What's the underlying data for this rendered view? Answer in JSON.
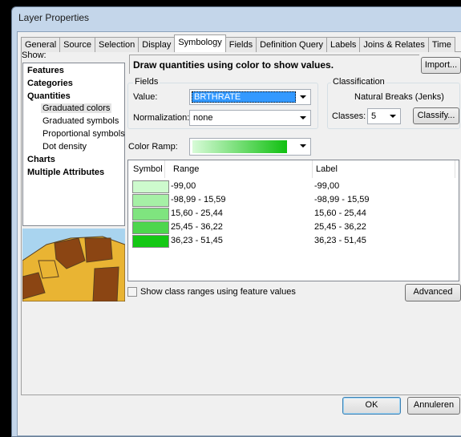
{
  "window": {
    "title": "Layer Properties"
  },
  "tabs": [
    "General",
    "Source",
    "Selection",
    "Display",
    "Symbology",
    "Fields",
    "Definition Query",
    "Labels",
    "Joins & Relates",
    "Time"
  ],
  "active_tab": "Symbology",
  "show": {
    "label": "Show:",
    "items": {
      "features": "Features",
      "categories": "Categories",
      "quantities": "Quantities",
      "graduated_colors": "Graduated colors",
      "graduated_symbols": "Graduated symbols",
      "proportional_symbols": "Proportional symbols",
      "dot_density": "Dot density",
      "charts": "Charts",
      "multiple_attributes": "Multiple Attributes"
    },
    "selected": "Graduated colors"
  },
  "description": "Draw quantities using color to show values.",
  "import_label": "Import...",
  "fields": {
    "title": "Fields",
    "value_label": "Value:",
    "value": "BRTHRATE",
    "normalization_label": "Normalization:",
    "normalization": "none"
  },
  "classification": {
    "title": "Classification",
    "method": "Natural Breaks (Jenks)",
    "classes_label": "Classes:",
    "classes": "5",
    "classify_label": "Classify..."
  },
  "color_ramp": {
    "label": "Color Ramp:",
    "from": "#d8fbd8",
    "to": "#10c010"
  },
  "table": {
    "headers": [
      "Symbol",
      "Range",
      "Label"
    ],
    "rows": [
      {
        "color": "#cdfacd",
        "range": "-99,00",
        "label": "-99,00"
      },
      {
        "color": "#a6f0a6",
        "range": "-98,99 - 15,59",
        "label": "-98,99 - 15,59"
      },
      {
        "color": "#7fe47f",
        "range": "15,60 - 25,44",
        "label": "15,60 - 25,44"
      },
      {
        "color": "#4dd64d",
        "range": "25,45 - 36,22",
        "label": "25,45 - 36,22"
      },
      {
        "color": "#14c814",
        "range": "36,23 - 51,45",
        "label": "36,23 - 51,45"
      }
    ]
  },
  "show_ranges_label": "Show class ranges using feature values",
  "advanced_label": "Advanced",
  "ok_label": "OK",
  "cancel_label": "Annuleren"
}
